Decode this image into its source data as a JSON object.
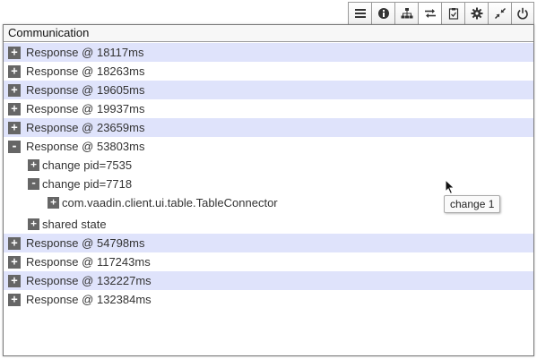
{
  "toolbar": {
    "buttons": [
      {
        "icon": "menu-icon",
        "label": "Menu"
      },
      {
        "icon": "info-icon",
        "label": "Info"
      },
      {
        "icon": "hierarchy-icon",
        "label": "Hierarchy"
      },
      {
        "icon": "network-icon",
        "label": "Communication",
        "active": true
      },
      {
        "icon": "clipboard-check-icon",
        "label": "Test bench"
      },
      {
        "icon": "gear-icon",
        "label": "Settings"
      },
      {
        "icon": "minimize-icon",
        "label": "Minimize"
      },
      {
        "icon": "power-icon",
        "label": "Close"
      }
    ]
  },
  "panel": {
    "title": "Communication",
    "rows": [
      {
        "label": "Response @ 18117ms",
        "toggle": "+"
      },
      {
        "label": "Response @ 18263ms",
        "toggle": "+"
      },
      {
        "label": "Response @ 19605ms",
        "toggle": "+"
      },
      {
        "label": "Response @ 19937ms",
        "toggle": "+"
      },
      {
        "label": "Response @ 23659ms",
        "toggle": "+"
      },
      {
        "label": "Response @ 53803ms",
        "toggle": "-",
        "children": [
          {
            "label": "change pid=7535",
            "toggle": "+"
          },
          {
            "label": "change pid=7718",
            "toggle": "-",
            "children": [
              {
                "label": "com.vaadin.client.ui.table.TableConnector",
                "toggle": "+"
              }
            ]
          },
          {
            "label": "shared state",
            "toggle": "+"
          }
        ]
      },
      {
        "label": "Response @ 54798ms",
        "toggle": "+"
      },
      {
        "label": "Response @ 117243ms",
        "toggle": "+"
      },
      {
        "label": "Response @ 132227ms",
        "toggle": "+"
      },
      {
        "label": "Response @ 132384ms",
        "toggle": "+"
      }
    ]
  },
  "tooltip": {
    "text": "change 1"
  },
  "colors": {
    "row_alt": "#dfe3fb",
    "toggle_bg": "#666666",
    "border": "#7a7a7a"
  }
}
